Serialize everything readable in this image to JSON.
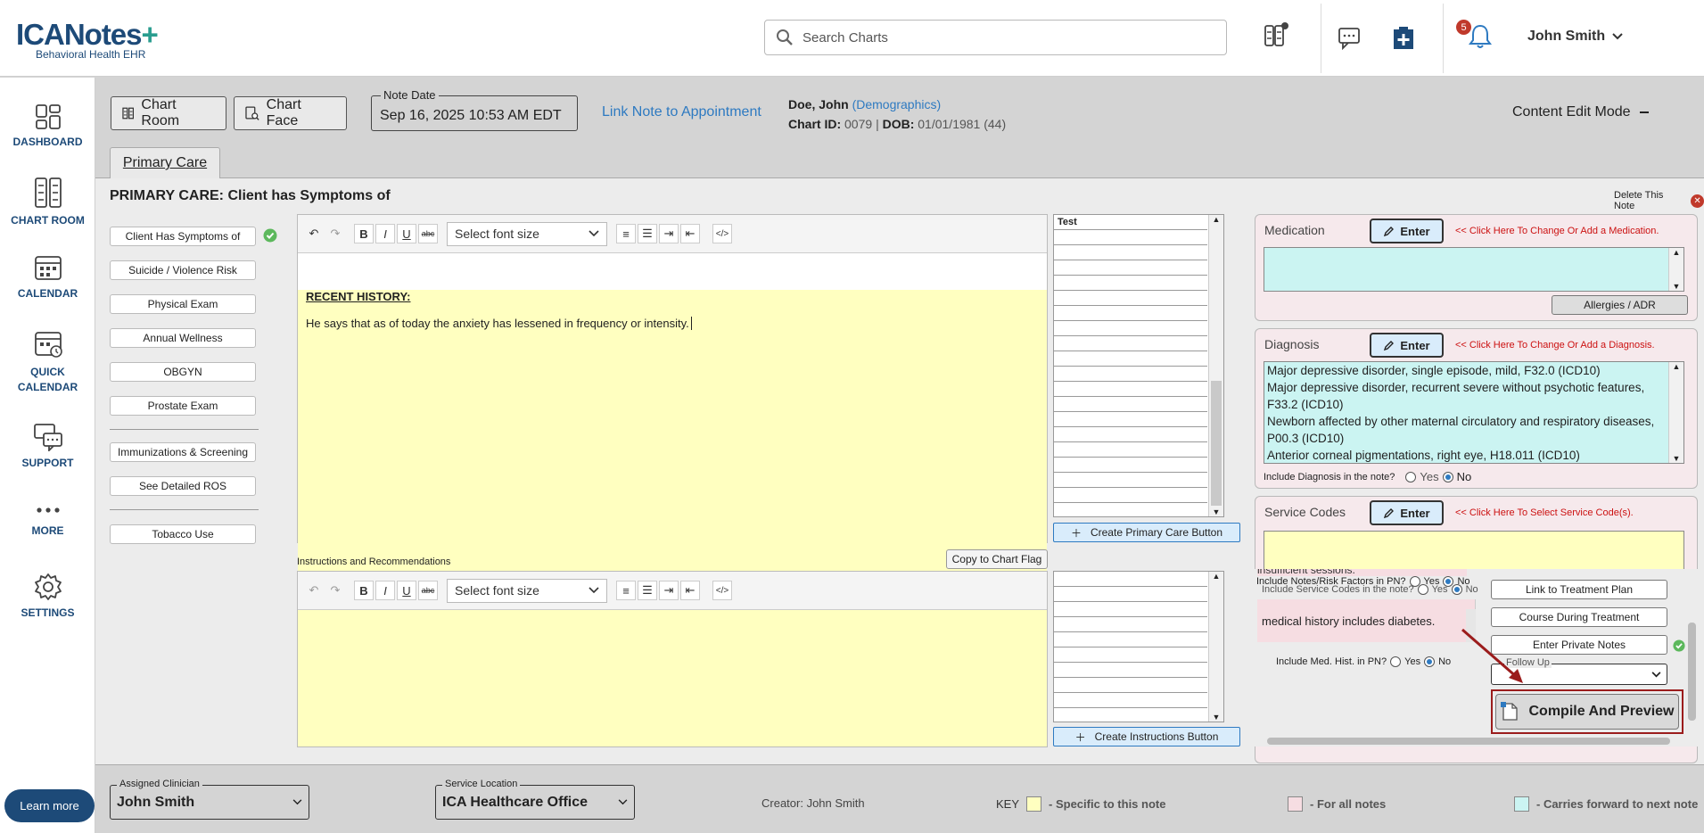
{
  "header": {
    "logo_main": "ICANotes",
    "logo_plus": "+",
    "logo_sub": "Behavioral Health EHR",
    "search_placeholder": "Search Charts",
    "notification_count": "5",
    "user_name": "John Smith"
  },
  "sidebar": {
    "items": [
      {
        "label": "DASHBOARD",
        "icon": "dashboard-icon"
      },
      {
        "label": "CHART ROOM",
        "icon": "chart-room-icon"
      },
      {
        "label": "CALENDAR",
        "icon": "calendar-icon"
      },
      {
        "label": "QUICK CALENDAR",
        "icon": "quick-calendar-icon"
      },
      {
        "label": "SUPPORT",
        "icon": "support-icon"
      },
      {
        "label": "MORE",
        "icon": "more-icon"
      },
      {
        "label": "SETTINGS",
        "icon": "gear-icon"
      }
    ],
    "learn_more": "Learn more"
  },
  "toolbar": {
    "chart_room": "Chart Room",
    "chart_face": "Chart Face",
    "note_date_label": "Note Date",
    "note_date_value": "Sep 16, 2025 10:53 AM EDT",
    "link_appointment": "Link Note to Appointment",
    "patient_name": "Doe, John",
    "demographics": "(Demographics)",
    "chart_id_label": "Chart ID:",
    "chart_id": "0079",
    "dob_label": "DOB:",
    "dob": "01/01/1981 (44)",
    "content_edit_mode": "Content Edit Mode"
  },
  "tab": {
    "label": "Primary Care"
  },
  "page": {
    "title": "PRIMARY CARE: Client has Symptoms of",
    "delete_note": "Delete This Note"
  },
  "left_buttons": [
    "Client Has Symptoms of",
    "Suicide / Violence Risk",
    "Physical Exam",
    "Annual Wellness",
    "OBGYN",
    "Prostate Exam",
    "Immunizations & Screening",
    "See Detailed ROS",
    "Tobacco Use"
  ],
  "editor": {
    "font_size_placeholder": "Select font size",
    "heading": "RECENT HISTORY:",
    "text": "He says that as of today the anxiety has lessened in frequency or intensity."
  },
  "grid": {
    "header": "Test",
    "create_primary": "Create Primary Care Button",
    "create_instructions": "Create Instructions Button"
  },
  "instructions": {
    "label": "Instructions and Recommendations",
    "copy_flag": "Copy to Chart Flag"
  },
  "medication": {
    "title": "Medication",
    "enter": "Enter",
    "hint": "<< Click Here To Change Or Add a Medication.",
    "allergies": "Allergies / ADR"
  },
  "diagnosis": {
    "title": "Diagnosis",
    "enter": "Enter",
    "hint": "<< Click Here To Change Or Add a Diagnosis.",
    "lines": [
      "Major depressive disorder, single episode, mild, F32.0 (ICD10)",
      "Major depressive disorder, recurrent severe without psychotic features,",
      "F33.2 (ICD10)",
      "Newborn affected by other maternal circulatory and respiratory diseases,",
      "P00.3 (ICD10)",
      "Anterior corneal pigmentations, right eye, H18.011 (ICD10)"
    ],
    "include_label": "Include Diagnosis in the note?",
    "yes": "Yes",
    "no": "No"
  },
  "service_codes": {
    "title": "Service Codes",
    "enter": "Enter",
    "hint": "<< Click Here To Select Service Code(s).",
    "include_label": "Include Service Codes in the note?",
    "yes": "Yes",
    "no": "No"
  },
  "overlap": {
    "insufficient": "insufficient sessions.",
    "include_notes_label": "Include Notes/Risk Factors in PN?",
    "yes": "Yes",
    "no": "No",
    "med_hist_fragment": "medical history includes diabetes.",
    "include_med_label": "Include Med. Hist. in PN?",
    "link_treatment": "Link to Treatment Plan",
    "course_treatment": "Course During Treatment",
    "private_notes": "Enter Private Notes",
    "follow_up": "Follow Up",
    "compile": "Compile And Preview"
  },
  "footer": {
    "clinician_label": "Assigned Clinician",
    "clinician": "John Smith",
    "location_label": "Service Location",
    "location": "ICA Healthcare Office",
    "creator": "Creator: John Smith",
    "key": "KEY",
    "key_specific": "- Specific to this note",
    "key_all": "- For all notes",
    "key_carries": "- Carries forward to next note"
  },
  "colors": {
    "brand": "#1d4a78",
    "link": "#2e7ac1",
    "yellow_note": "#ffffc0",
    "pink_all": "#f6dde2",
    "cyan_forward": "#cbf4f2",
    "hint_red": "#cc1111"
  }
}
